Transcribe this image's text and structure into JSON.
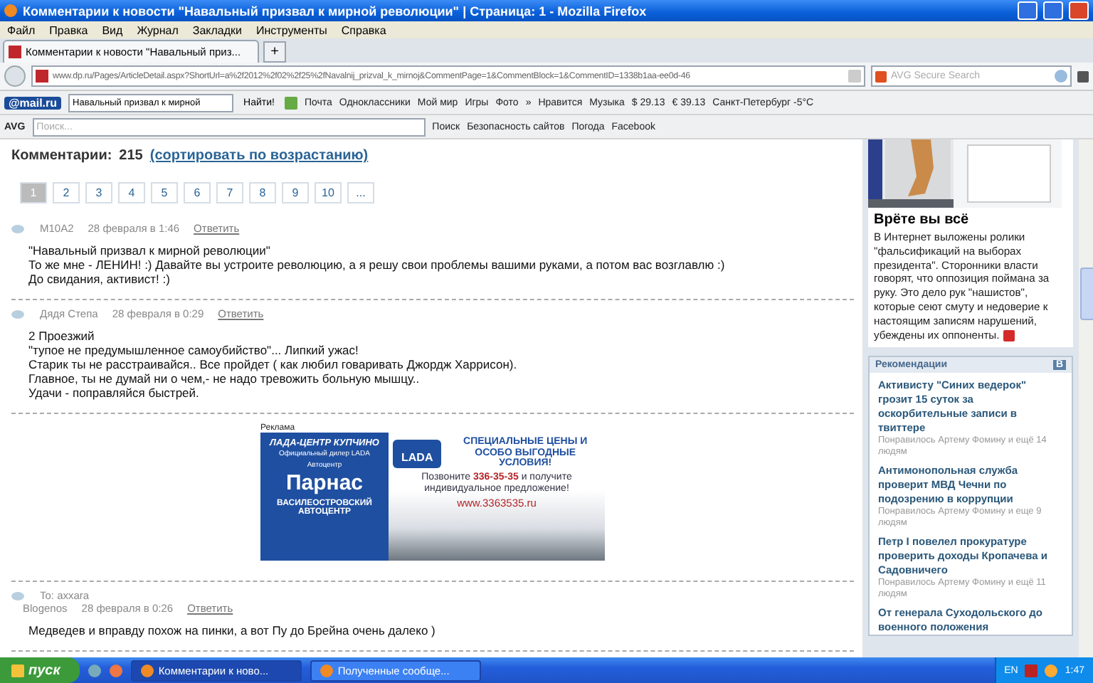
{
  "window": {
    "title": "Комментарии к новости \"Навальный призвал к мирной революции\" | Страница: 1 - Mozilla Firefox"
  },
  "menu": [
    "Файл",
    "Правка",
    "Вид",
    "Журнал",
    "Закладки",
    "Инструменты",
    "Справка"
  ],
  "tabs": [
    {
      "label": "Комментарии к новости \"Навальный приз...",
      "selected": true
    }
  ],
  "new_tab": "+",
  "address": {
    "url": "www.dp.ru/Pages/ArticleDetail.aspx?ShortUrl=a%2f2012%2f02%2f25%2fNavalnij_prizval_k_mirnoj&CommentPage=1&CommentBlock=1&CommentID=1338b1aa-ee0d-46",
    "search_placeholder": "AVG Secure Search"
  },
  "mail_bar": {
    "logo": "@mail.ru",
    "query": "Навальный призвал к мирной",
    "find": "Найти!",
    "links": [
      "Почта",
      "Одноклассники",
      "Мой мир",
      "Игры",
      "Фото"
    ],
    "more": "»",
    "extra": [
      "Нравится",
      "Музыка"
    ],
    "usd_sign": "$",
    "usd": "29.13",
    "eur_sign": "€",
    "eur": "39.13",
    "weather": "Санкт-Петербург -5°C"
  },
  "avg_bar": {
    "logo": "AVG",
    "placeholder": "Поиск...",
    "search": "Поиск",
    "safety": "Безопасность сайтов",
    "weather": "Погода",
    "facebook": "Facebook"
  },
  "comments_header": {
    "label": "Комментарии:",
    "count": "215",
    "sort": "(сортировать по возрастанию)"
  },
  "pages": [
    {
      "label": "1",
      "selected": true
    },
    {
      "label": "2",
      "selected": false
    },
    {
      "label": "3",
      "selected": false
    },
    {
      "label": "4",
      "selected": false
    },
    {
      "label": "5",
      "selected": false
    },
    {
      "label": "6",
      "selected": false
    },
    {
      "label": "7",
      "selected": false
    },
    {
      "label": "8",
      "selected": false
    },
    {
      "label": "9",
      "selected": false
    },
    {
      "label": "10",
      "selected": false
    },
    {
      "label": "...",
      "selected": false
    }
  ],
  "comments_top": [
    {
      "author": "M10A2",
      "date": "28 февраля в 1:46",
      "reply": "Ответить",
      "lines": [
        "\"Навальный призвал к мирной революции\"",
        "То же мне - ЛЕНИН! :) Давайте вы устроите революцию, а я решу свои проблемы вашими руками, а потом вас возглавлю :)",
        "До свидания, активист! :)"
      ]
    },
    {
      "author": "Дядя Степа",
      "date": "28 февраля в 0:29",
      "reply": "Ответить",
      "lines": [
        "2 Проезжий",
        "\"тупое не предумышленное самоубийство\"... Липкий ужас!",
        "Старик ты не расстраивайся.. Все пройдет ( как любил говаривать Джордж Харрисон).",
        "Главное, ты не думай ни о чем,- не надо тревожить больную мышцу..",
        "Удачи - поправляйся быстрей."
      ]
    }
  ],
  "ad": {
    "label": "Реклама",
    "dealer": "ЛАДА-ЦЕНТР КУПЧИНО",
    "dealer_sub": "Официальный дилер LADA",
    "brand_small": "Автоцентр",
    "brand": "Парнас",
    "center": "ВАСИЛЕОСТРОВСКИЙ АВТОЦЕНТР",
    "lada": "LADA",
    "headline": "СПЕЦИАЛЬНЫЕ ЦЕНЫ И ОСОБО ВЫГОДНЫЕ УСЛОВИЯ!",
    "call": "Позвоните **336-35-35** и получите индивидуальное предложение!",
    "site": "www.3363535.ru"
  },
  "comments_bottom": [
    {
      "to": "To: axxara",
      "author": "Blogenos",
      "date": "28 февраля в 0:26",
      "reply": "Ответить",
      "lines": [
        "Медведев и вправду похож на пинки, а вот Пу до Брейна очень далеко )"
      ]
    }
  ],
  "sidebar": {
    "story_title": "Врёте вы всё",
    "story_text": "В Интернет выложены ролики \"фальсификаций на выборах президента\". Сторонники власти говорят, что оппозиция поймана за руку. Это дело рук \"нашистов\", которые сеют смуту и недоверие к настоящим записям нарушений, убеждены их оппоненты.",
    "rec_title": "Рекомендации",
    "rec_badge": "В",
    "recommendations": [
      {
        "title": "Активисту \"Синих ведерок\" грозит 15 суток за оскорбительные записи в твиттере",
        "likes": "Понравилось Артему Фомину и ещё 14 людям"
      },
      {
        "title": "Антимонопольная служба проверит МВД Чечни по подозрению в коррупции",
        "likes": "Понравилось Артему Фомину и еще 9 людям"
      },
      {
        "title": "Петр I повелел прокуратуре проверить доходы Кропачева и Садовничего",
        "likes": "Понравилось Артему Фомину и ещё 11 людям"
      },
      {
        "title": "От генерала Суходольского до военного положения"
      }
    ]
  },
  "taskbar": {
    "start": "пуск",
    "tasks": [
      {
        "label": "Комментарии к ново...",
        "selected": true
      },
      {
        "label": "Полученные сообще...",
        "selected": false
      }
    ],
    "lang": "EN",
    "time": "1:47"
  }
}
